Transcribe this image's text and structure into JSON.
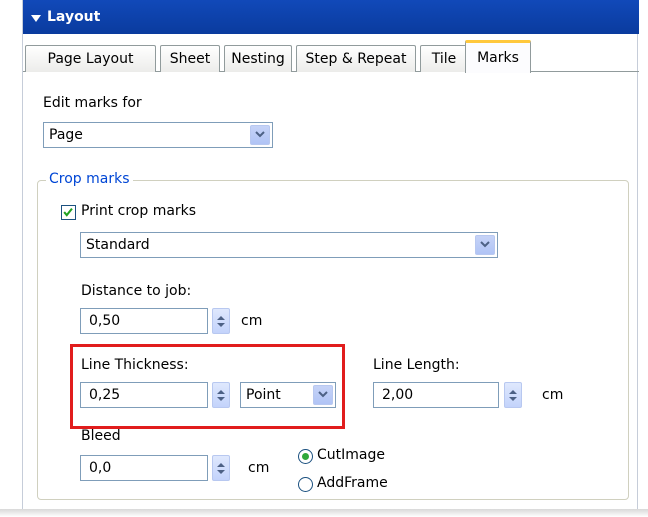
{
  "header": {
    "title": "Layout"
  },
  "tabs": [
    {
      "label": "Page Layout",
      "active": false
    },
    {
      "label": "Sheet",
      "active": false
    },
    {
      "label": "Nesting",
      "active": false
    },
    {
      "label": "Step & Repeat",
      "active": false
    },
    {
      "label": "Tile",
      "active": false
    },
    {
      "label": "Marks",
      "active": true
    }
  ],
  "edit_marks": {
    "label": "Edit marks for",
    "value": "Page"
  },
  "crop_marks": {
    "legend": "Crop marks",
    "print_label": "Print crop marks",
    "print_checked": true,
    "style_value": "Standard",
    "distance": {
      "label": "Distance to job:",
      "value": "0,50",
      "unit": "cm"
    },
    "line_thickness": {
      "label": "Line Thickness:",
      "value": "0,25",
      "unit_value": "Point"
    },
    "line_length": {
      "label": "Line Length:",
      "value": "2,00",
      "unit": "cm"
    },
    "bleed": {
      "label": "Bleed",
      "value": "0,0",
      "unit": "cm"
    },
    "mode_options": [
      {
        "label": "CutImage",
        "checked": true
      },
      {
        "label": "AddFrame",
        "checked": false
      }
    ]
  },
  "colors": {
    "header": "#0a3b9e",
    "legend": "#0046d5",
    "highlight": "#e11d1d",
    "tab_accent": "#ffc83c"
  }
}
